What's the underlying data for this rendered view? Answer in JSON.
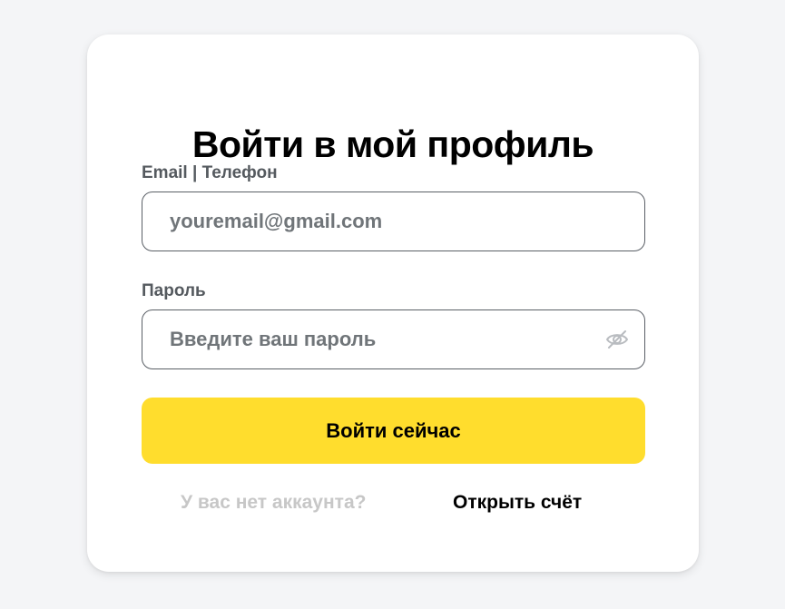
{
  "login": {
    "title": "Войти в мой профиль",
    "email_label": "Email | Телефон",
    "email_placeholder": "youremail@gmail.com",
    "email_value": "",
    "password_label": "Пароль",
    "password_placeholder": "Введите ваш пароль",
    "password_value": "",
    "password_toggle_icon": "eye-off-icon",
    "submit_label": "Войти сейчас",
    "no_account_text": "У вас нет аккаунта?",
    "open_account_link": "Открыть счёт"
  },
  "colors": {
    "background": "#f4f5f7",
    "card": "#ffffff",
    "accent": "#ffdd2d",
    "label": "#555a5f",
    "placeholder": "#707579",
    "muted": "#c7c7c7"
  }
}
